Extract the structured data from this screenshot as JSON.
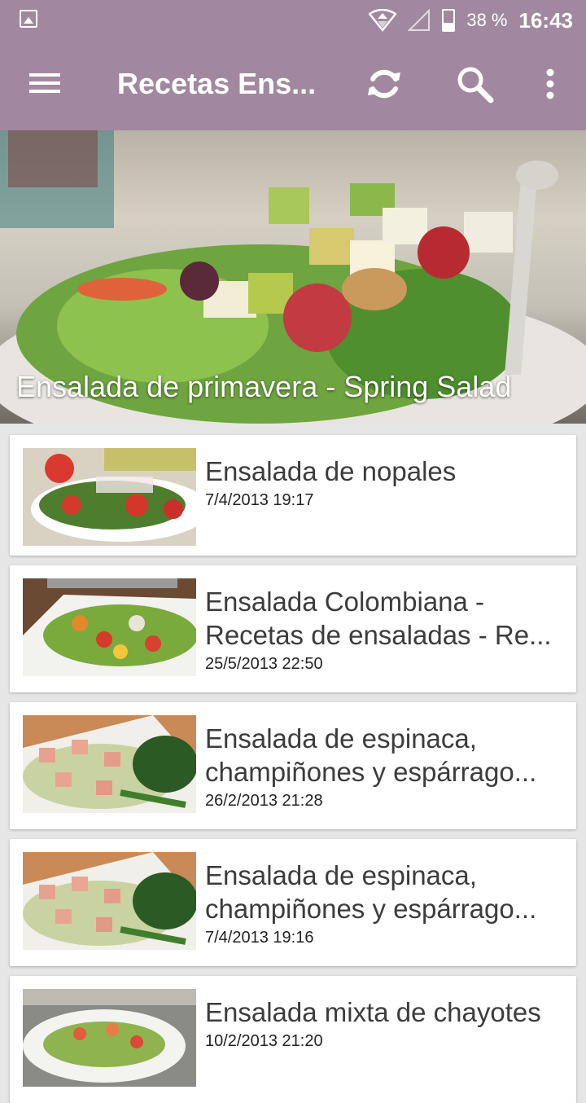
{
  "status": {
    "battery_percent_text": "38 %",
    "battery_level": 0.38,
    "time": "16:43"
  },
  "appbar": {
    "title": "Recetas Ens...",
    "icons": [
      "menu-icon",
      "refresh-icon",
      "search-icon",
      "more-vert-icon"
    ]
  },
  "hero": {
    "caption": "Ensalada de primavera - Spring Salad"
  },
  "recipes": [
    {
      "title": "Ensalada de nopales",
      "date": "7/4/2013 19:17"
    },
    {
      "title": "Ensalada Colombiana - Recetas de ensaladas - Re...",
      "date": "25/5/2013 22:50"
    },
    {
      "title": "Ensalada de espinaca, champiñones y espárrago...",
      "date": "26/2/2013 21:28"
    },
    {
      "title": "Ensalada de espinaca, champiñones y espárrago...",
      "date": "7/4/2013 19:16"
    },
    {
      "title": "Ensalada mixta de chayotes",
      "date": "10/2/2013 21:20"
    }
  ],
  "colors": {
    "appbar": "#a2889f",
    "background": "#e6e6e6",
    "card": "#ffffff"
  }
}
